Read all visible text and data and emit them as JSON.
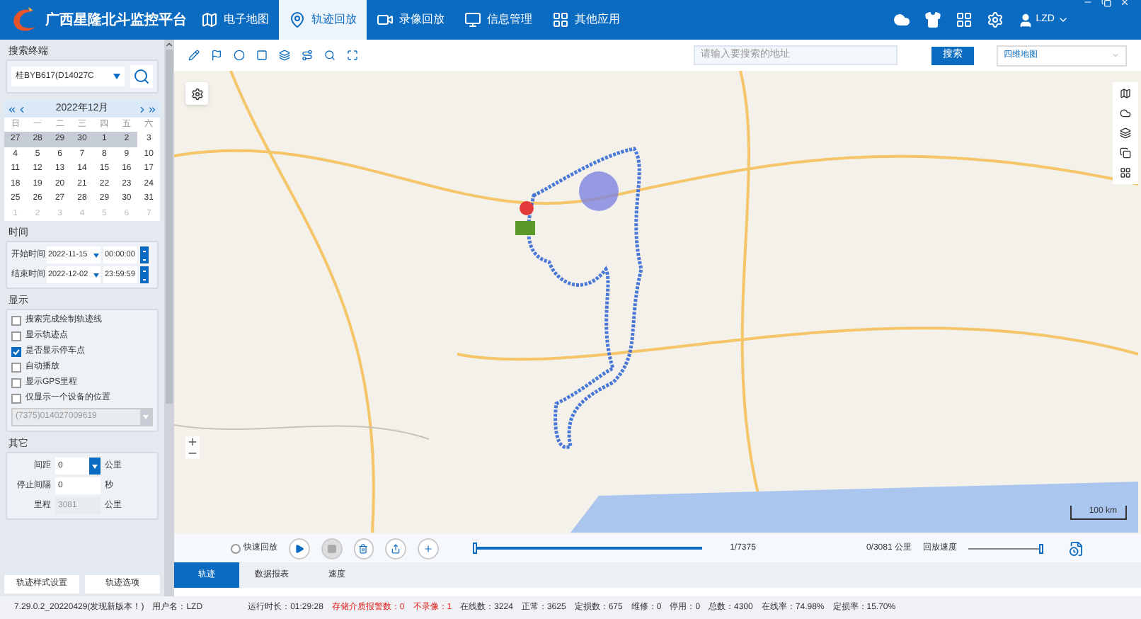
{
  "header": {
    "title": "广西星隆北斗监控平台",
    "nav": [
      {
        "label": "电子地图",
        "selected": false
      },
      {
        "label": "轨迹回放",
        "selected": true
      },
      {
        "label": "录像回放",
        "selected": false
      },
      {
        "label": "信息管理",
        "selected": false
      },
      {
        "label": "其他应用",
        "selected": false
      }
    ],
    "user": "LZD"
  },
  "sidebar": {
    "search_legend": "搜索终端",
    "vehicle": "桂BYB617(D14027C",
    "calendar": {
      "month": "2022年12月",
      "weekdays": [
        "日",
        "一",
        "二",
        "三",
        "四",
        "五",
        "六"
      ],
      "days": [
        {
          "d": "27",
          "muted": false,
          "selected": true
        },
        {
          "d": "28",
          "muted": false,
          "selected": true
        },
        {
          "d": "29",
          "muted": false,
          "selected": true
        },
        {
          "d": "30",
          "muted": false,
          "selected": true
        },
        {
          "d": "1",
          "muted": false,
          "selected": true
        },
        {
          "d": "2",
          "muted": false,
          "selected": true
        },
        {
          "d": "3",
          "muted": false,
          "selected": false
        },
        {
          "d": "4",
          "muted": false,
          "selected": false
        },
        {
          "d": "5",
          "muted": false,
          "selected": false
        },
        {
          "d": "6",
          "muted": false,
          "selected": false
        },
        {
          "d": "7",
          "muted": false,
          "selected": false
        },
        {
          "d": "8",
          "muted": false,
          "selected": false
        },
        {
          "d": "9",
          "muted": false,
          "selected": false
        },
        {
          "d": "10",
          "muted": false,
          "selected": false
        },
        {
          "d": "11",
          "muted": false,
          "selected": false
        },
        {
          "d": "12",
          "muted": false,
          "selected": false
        },
        {
          "d": "13",
          "muted": false,
          "selected": false
        },
        {
          "d": "14",
          "muted": false,
          "selected": false
        },
        {
          "d": "15",
          "muted": false,
          "selected": false
        },
        {
          "d": "16",
          "muted": false,
          "selected": false
        },
        {
          "d": "17",
          "muted": false,
          "selected": false
        },
        {
          "d": "18",
          "muted": false,
          "selected": false
        },
        {
          "d": "19",
          "muted": false,
          "selected": false
        },
        {
          "d": "20",
          "muted": false,
          "selected": false
        },
        {
          "d": "21",
          "muted": false,
          "selected": false
        },
        {
          "d": "22",
          "muted": false,
          "selected": false
        },
        {
          "d": "23",
          "muted": false,
          "selected": false
        },
        {
          "d": "24",
          "muted": false,
          "selected": false
        },
        {
          "d": "25",
          "muted": false,
          "selected": false
        },
        {
          "d": "26",
          "muted": false,
          "selected": false
        },
        {
          "d": "27",
          "muted": false,
          "selected": false
        },
        {
          "d": "28",
          "muted": false,
          "selected": false
        },
        {
          "d": "29",
          "muted": false,
          "selected": false
        },
        {
          "d": "30",
          "muted": false,
          "selected": false
        },
        {
          "d": "31",
          "muted": false,
          "selected": false
        },
        {
          "d": "1",
          "muted": true,
          "selected": false
        },
        {
          "d": "2",
          "muted": true,
          "selected": false
        },
        {
          "d": "3",
          "muted": true,
          "selected": false
        },
        {
          "d": "4",
          "muted": true,
          "selected": false
        },
        {
          "d": "5",
          "muted": true,
          "selected": false
        },
        {
          "d": "6",
          "muted": true,
          "selected": false
        },
        {
          "d": "7",
          "muted": true,
          "selected": false
        }
      ]
    },
    "time_legend": "时间",
    "start_label": "开始时间",
    "start_date": "2022-11-15",
    "start_time": "00:00:00",
    "end_label": "结束时间",
    "end_date": "2022-12-02",
    "end_time": "23:59:59",
    "display_legend": "显示",
    "options": [
      {
        "label": "搜索完成绘制轨迹线",
        "checked": false
      },
      {
        "label": "显示轨迹点",
        "checked": false
      },
      {
        "label": "是否显示停车点",
        "checked": true
      },
      {
        "label": "自动播放",
        "checked": false
      },
      {
        "label": "显示GPS里程",
        "checked": false
      },
      {
        "label": "仅显示一个设备的位置",
        "checked": false
      }
    ],
    "device": "(7375)014027009619",
    "other_legend": "其它",
    "spacing_label": "间距",
    "spacing": "0",
    "spacing_unit": "公里",
    "stop_label": "停止间隔",
    "stop": "0",
    "stop_unit": "秒",
    "mileage_label": "里程",
    "mileage": "3081",
    "mileage_unit": "公里",
    "buttons": [
      "轨迹样式设置",
      "轨迹选项"
    ]
  },
  "map": {
    "search_placeholder": "请输入要搜索的地址",
    "search_button": "搜索",
    "map_type": "四维地图",
    "scale": "100 km"
  },
  "playback": {
    "fast_label": "快速回放",
    "fast": false,
    "level": 0.0,
    "progress": "1/7375",
    "distance": "0/3081 公里",
    "speed": {
      "label": "回放速度",
      "level": 1.0
    }
  },
  "tabs": [
    {
      "label": "轨迹",
      "selected": true
    },
    {
      "label": "数据报表",
      "selected": false
    },
    {
      "label": "速度",
      "selected": false
    }
  ],
  "status": {
    "version": "7.29.0.2_20220429(发现新版本！)",
    "user": "用户名：LZD",
    "items": [
      {
        "text": "运行时长：01:29:28",
        "alert": false
      },
      {
        "text": "存储介质报警数：0",
        "alert": true
      },
      {
        "text": "不录像：1",
        "alert": true
      },
      {
        "text": "在线数：3224",
        "alert": false
      },
      {
        "text": "正常：3625",
        "alert": false
      },
      {
        "text": "定损数：675",
        "alert": false
      },
      {
        "text": "维修：0",
        "alert": false
      },
      {
        "text": "停用：0",
        "alert": false
      },
      {
        "text": "总数：4300",
        "alert": false
      },
      {
        "text": "在线率：74.98%",
        "alert": false
      },
      {
        "text": "定损率：15.70%",
        "alert": false
      }
    ]
  }
}
